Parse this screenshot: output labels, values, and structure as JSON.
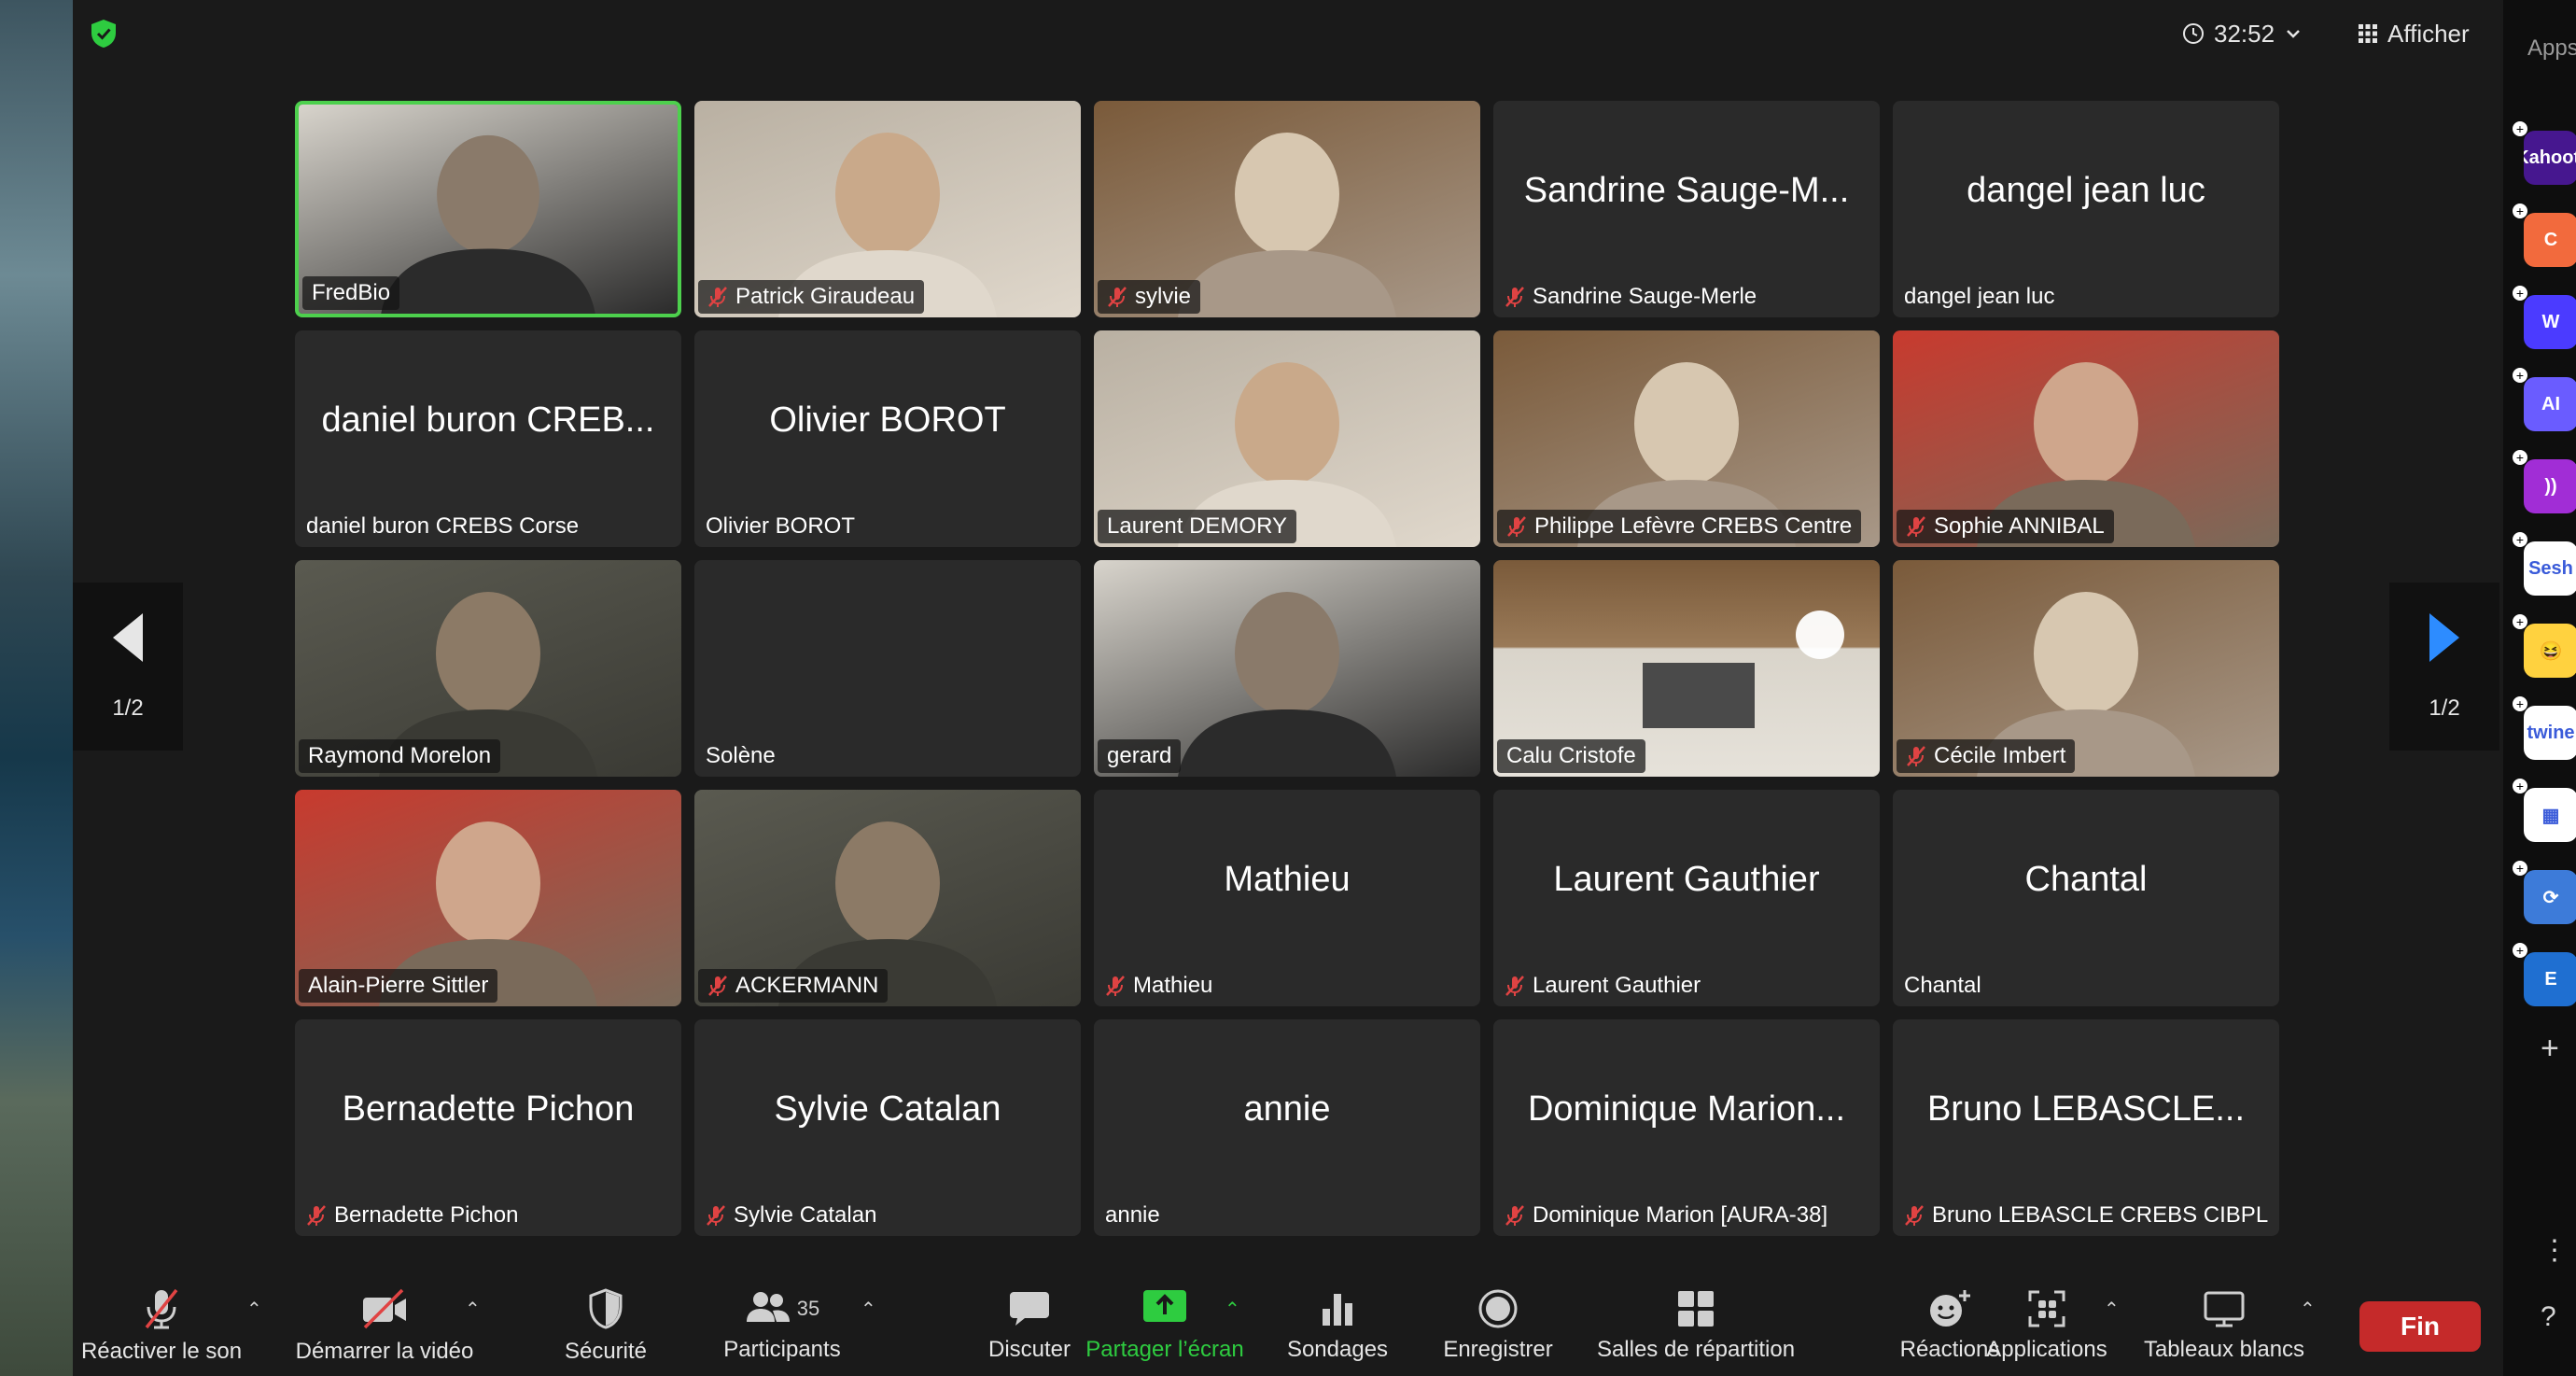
{
  "topbar": {
    "timer": "32:52",
    "view_label": "Afficher"
  },
  "pager": {
    "left_page": "1/2",
    "right_page": "1/2"
  },
  "participants": [
    {
      "name": "FredBio",
      "video": "head",
      "muted": false,
      "active": true
    },
    {
      "name": "Patrick Giraudeau",
      "video": "head",
      "muted": true
    },
    {
      "name": "sylvie",
      "video": "head",
      "muted": true
    },
    {
      "name": "Sandrine Sauge-Merle",
      "display": "Sandrine Sauge-M...",
      "muted": true
    },
    {
      "name": "dangel jean luc",
      "display": "dangel jean luc",
      "muted": false
    },
    {
      "name": "daniel buron CREBS Corse",
      "display": "daniel buron CREB...",
      "muted": false
    },
    {
      "name": "Olivier BOROT",
      "display": "Olivier BOROT",
      "muted": false
    },
    {
      "name": "Laurent DEMORY",
      "video": "head",
      "muted": false
    },
    {
      "name": "Philippe Lefèvre CREBS Centre",
      "video": "head",
      "muted": true
    },
    {
      "name": "Sophie ANNIBAL",
      "video": "head",
      "muted": true
    },
    {
      "name": "Raymond Morelon",
      "video": "head",
      "muted": false
    },
    {
      "name": "Solène",
      "display": "",
      "muted": false
    },
    {
      "name": "gerard",
      "video": "head",
      "muted": false
    },
    {
      "name": "Calu Cristofe",
      "video": "room",
      "muted": false
    },
    {
      "name": "Cécile Imbert",
      "video": "head",
      "muted": true
    },
    {
      "name": "Alain-Pierre Sittler",
      "video": "head",
      "muted": false
    },
    {
      "name": "ACKERMANN",
      "video": "head",
      "muted": true
    },
    {
      "name": "Mathieu",
      "display": "Mathieu",
      "muted": true
    },
    {
      "name": "Laurent Gauthier",
      "display": "Laurent Gauthier",
      "muted": true
    },
    {
      "name": "Chantal",
      "display": "Chantal",
      "muted": false
    },
    {
      "name": "Bernadette Pichon",
      "display": "Bernadette Pichon",
      "muted": true
    },
    {
      "name": "Sylvie Catalan",
      "display": "Sylvie Catalan",
      "muted": true
    },
    {
      "name": "annie",
      "display": "annie",
      "muted": false
    },
    {
      "name": "Dominique Marion [AURA-38]",
      "display": "Dominique Marion...",
      "muted": true
    },
    {
      "name": "Bruno LEBASCLE CREBS CIBPL",
      "display": "Bruno LEBASCLE...",
      "muted": true
    }
  ],
  "toolbar": {
    "unmute": "Réactiver le son",
    "start_video": "Démarrer la vidéo",
    "security": "Sécurité",
    "participants": "Participants",
    "participants_count": "35",
    "chat": "Discuter",
    "share": "Partager l’écran",
    "polls": "Sondages",
    "record": "Enregistrer",
    "breakout": "Salles de répartition",
    "reactions": "Réactions",
    "apps": "Applications",
    "whiteboards": "Tableaux blancs",
    "end": "Fin"
  },
  "apps_panel": {
    "title": "Apps",
    "apps": [
      {
        "name": "Kahoot!",
        "text": "Kahoot!",
        "color": "#46178f"
      },
      {
        "name": "app-orange",
        "text": "C",
        "color": "#f26a3d"
      },
      {
        "name": "app-w",
        "text": "W",
        "color": "#4b3bff"
      },
      {
        "name": "app-ai",
        "text": "AI",
        "color": "#6a5cff"
      },
      {
        "name": "app-purple",
        "text": "))",
        "color": "#a12dd6"
      },
      {
        "name": "Sesh",
        "text": "Sesh",
        "color": "#ffffff"
      },
      {
        "name": "app-emoji",
        "text": "😆",
        "color": "#ffd23f"
      },
      {
        "name": "twine",
        "text": "twine",
        "color": "#ffffff"
      },
      {
        "name": "app-tiles",
        "text": "▦",
        "color": "#ffffff"
      },
      {
        "name": "app-sync",
        "text": "⟳",
        "color": "#3d7bd9"
      },
      {
        "name": "app-blue",
        "text": "E",
        "color": "#1f6fd1"
      }
    ]
  },
  "colors": {
    "active_border": "#4dd04d",
    "share_green": "#2ecc40",
    "end_red": "#c52a2a",
    "pager_arrow_blue": "#2d8cff"
  }
}
